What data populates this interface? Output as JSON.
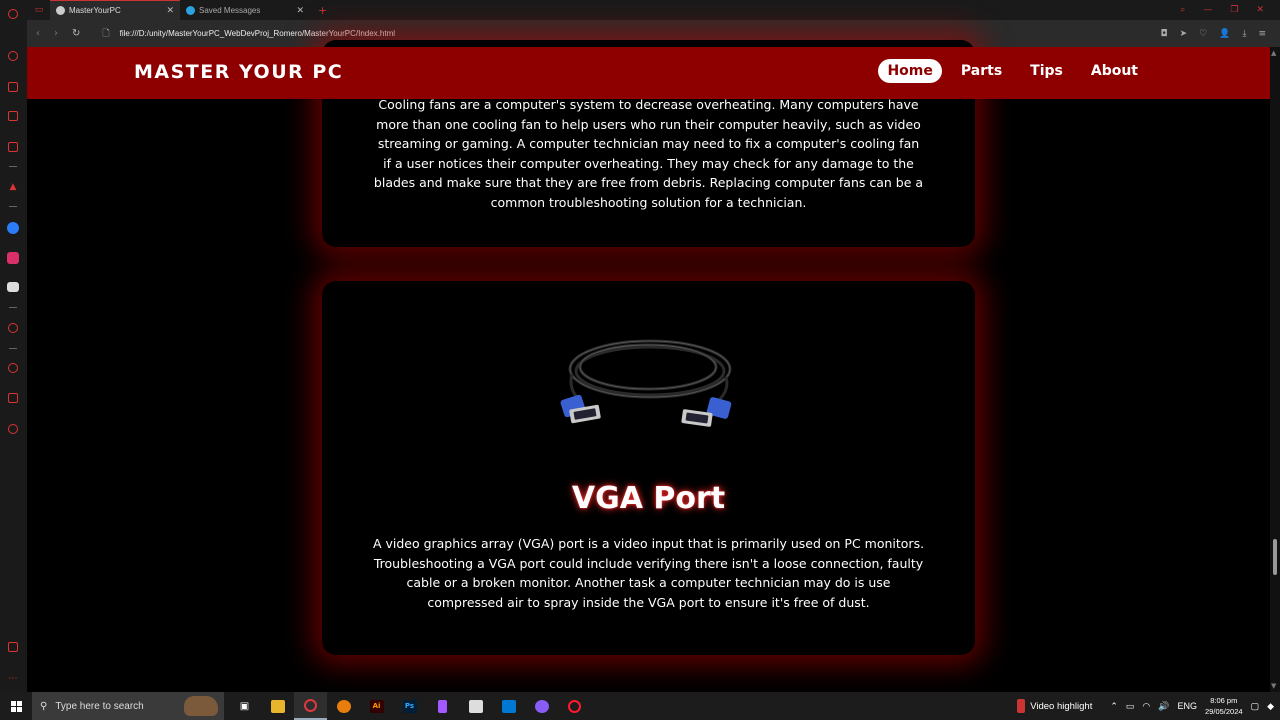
{
  "browser": {
    "tabs": [
      {
        "title": "MasterYourPC",
        "active": true
      },
      {
        "title": "Saved Messages",
        "active": false
      }
    ],
    "new_tab": "+",
    "url": "file:///D:/unity/MasterYourPC_WebDevProj_Romero/MasterYourPC/Index.html"
  },
  "site": {
    "brand": "MASTER YOUR PC",
    "nav": [
      "Home",
      "Parts",
      "Tips",
      "About"
    ],
    "active_nav": "Home",
    "accent_color": "#8e0000"
  },
  "cards": [
    {
      "text": "Cooling fans are a computer's system to decrease overheating. Many computers have more than one cooling fan to help users who run their computer heavily, such as video streaming or gaming. A computer technician may need to fix a computer's cooling fan if a user notices their computer overheating. They may check for any damage to the blades and make sure that they are free from debris. Replacing computer fans can be a common troubleshooting solution for a technician."
    },
    {
      "title": "VGA Port",
      "image": "vga-cable",
      "text": "A video graphics array (VGA) port is a video input that is primarily used on PC monitors. Troubleshooting a VGA port could include verifying there isn't a loose connection, faulty cable or a broken monitor. Another task a computer technician may do is use compressed air to spray inside the VGA port to ensure it's free of dust."
    }
  ],
  "taskbar": {
    "search_placeholder": "Type here to search",
    "news": "Video highlight",
    "language": "ENG",
    "time": "8:06 pm",
    "date": "29/05/2024"
  }
}
